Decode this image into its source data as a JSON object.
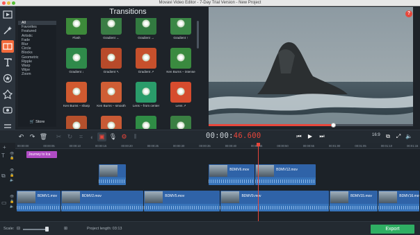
{
  "window": {
    "title": "Movavi Video Editor - 7-Day Trial Version - New Project"
  },
  "colors": {
    "accent": "#f2693a",
    "playhead": "#e8463b",
    "export": "#2fae63",
    "clip": "#2f63a8",
    "title_clip": "#b04cc4"
  },
  "left_tools": [
    {
      "name": "import-icon"
    },
    {
      "name": "magic-wand-icon"
    },
    {
      "name": "filters-icon"
    },
    {
      "name": "titles-icon"
    },
    {
      "name": "stickers-icon"
    },
    {
      "name": "callouts-icon"
    },
    {
      "name": "media-icon"
    },
    {
      "name": "more-icon"
    }
  ],
  "transitions": {
    "title": "Transitions",
    "categories": [
      "All",
      "Favorites",
      "Featured",
      "Artistic",
      "Fade",
      "Blur",
      "Circle",
      "Blocks",
      "Geometric",
      "Ripple",
      "Warp",
      "Wipe",
      "Zoom"
    ],
    "selected_category": "All",
    "store_label": "Store",
    "items": [
      {
        "label": "Flash",
        "color": "#3d8a3a"
      },
      {
        "label": "Gradient ←",
        "color": "#3a7d45"
      },
      {
        "label": "Gradient →",
        "color": "#327a40"
      },
      {
        "label": "Gradient ↑",
        "color": "#3b8746"
      },
      {
        "label": "Gradient ↓",
        "color": "#2f8a4a"
      },
      {
        "label": "Gradient ↖",
        "color": "#b84a2a"
      },
      {
        "label": "Gradient ↗",
        "color": "#c6502c"
      },
      {
        "label": "Ken Burns – intense",
        "color": "#3a8a3f"
      },
      {
        "label": "Ken Burns – sharp",
        "color": "#d05a30"
      },
      {
        "label": "Ken Burns – smooth",
        "color": "#cf5e35"
      },
      {
        "label": "Lens – from center",
        "color": "#2a9c6a"
      },
      {
        "label": "Lens ↗",
        "color": "#d64c2e"
      },
      {
        "label": "",
        "color": "#b5502c"
      },
      {
        "label": "",
        "color": "#c95a35"
      },
      {
        "label": "",
        "color": "#2f8c45"
      },
      {
        "label": "",
        "color": "#3a7f42"
      }
    ]
  },
  "player": {
    "time_main": "00:00:",
    "time_frac": "46.600",
    "progress": 0.61,
    "aspect_label": "16:9",
    "help": "?"
  },
  "timeline": {
    "ruler": [
      "00:00:00",
      "00:00:05",
      "00:00:10",
      "00:00:15",
      "00:00:20",
      "00:00:25",
      "00:00:30",
      "00:00:35",
      "00:00:40",
      "00:00:45",
      "00:00:50",
      "00:00:55",
      "00:01:00",
      "00:01:05",
      "00:01:10",
      "00:01:15"
    ],
    "title_clip": "Journey to Ica",
    "overlay_clips": [
      {
        "label": "",
        "start": 0.207,
        "width": 0.068
      },
      {
        "label": "BDMV6.mov",
        "start": 0.478,
        "width": 0.115
      },
      {
        "label": "BDMV12.mov",
        "start": 0.593,
        "width": 0.151
      }
    ],
    "main_clips": [
      {
        "label": "BDMV1.mov",
        "start": 0.0,
        "width": 0.11
      },
      {
        "label": "BDMV2.mov",
        "start": 0.11,
        "width": 0.206
      },
      {
        "label": "BDMV5.mov",
        "start": 0.316,
        "width": 0.19
      },
      {
        "label": "BDMV9.mov",
        "start": 0.506,
        "width": 0.27
      },
      {
        "label": "BDMV15.mov",
        "start": 0.776,
        "width": 0.121
      },
      {
        "label": "BDMV16.mov",
        "start": 0.897,
        "width": 0.103
      }
    ]
  },
  "footer": {
    "scale_label": "Scale:",
    "project_length": "Project length:  03:13",
    "export_label": "Export"
  }
}
